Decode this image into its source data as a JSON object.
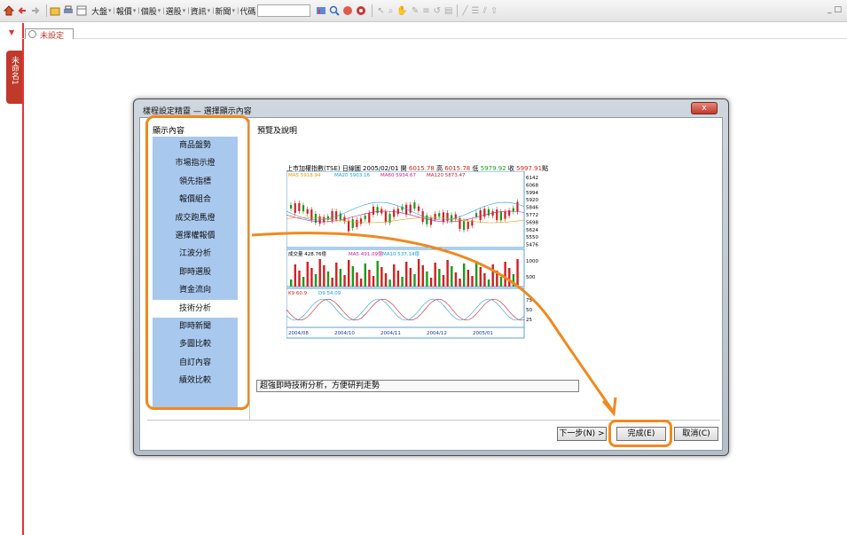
{
  "toolbar": {
    "menus": [
      "大盤",
      "報價",
      "個股",
      "選股",
      "資訊",
      "新聞",
      "代碼"
    ],
    "window_control": "_ □"
  },
  "document": {
    "tab_label": "未設定",
    "vertical_tab_label": "未命名1"
  },
  "dialog": {
    "title": "樣程設定精靈 — 選擇顯示內容",
    "close_label": "x",
    "list_header": "顯示內容",
    "items": [
      {
        "label": "商品盤勢",
        "selected": false
      },
      {
        "label": "市場指示燈",
        "selected": false
      },
      {
        "label": "領先指標",
        "selected": false
      },
      {
        "label": "報價組合",
        "selected": false
      },
      {
        "label": "成交跑馬燈",
        "selected": false
      },
      {
        "label": "選擇權報價",
        "selected": false
      },
      {
        "label": "江波分析",
        "selected": false
      },
      {
        "label": "即時選股",
        "selected": false
      },
      {
        "label": "資金流向",
        "selected": false
      },
      {
        "label": "技術分析",
        "selected": true
      },
      {
        "label": "即時新聞",
        "selected": false
      },
      {
        "label": "多圖比較",
        "selected": false
      },
      {
        "label": "自訂內容",
        "selected": false
      },
      {
        "label": "績效比較",
        "selected": false
      }
    ],
    "preview_header": "預覽及說明",
    "description": "超強即時技術分析，方便研判走勢",
    "buttons": {
      "next": "下一步(N) >",
      "done": "完成(E)",
      "cancel": "取消(C)"
    }
  },
  "preview_chart": {
    "title_prefix": "上市加權指數(TSE) 日線圖 2005/02/01",
    "open_label": "開",
    "open": "6015.78",
    "high_label": "高",
    "high": "6015.78",
    "low_label": "低",
    "low": "5979.92",
    "close_label": "收",
    "close": "5997.91",
    "close_unit": "點",
    "ma_labels": [
      "MA5 5918.94",
      "MA20 5903.16",
      "MA60 5934.67",
      "MA120 5873.47"
    ],
    "price_axis": [
      "6142",
      "6068",
      "5994",
      "5920",
      "5846",
      "5772",
      "5698",
      "5624",
      "5550",
      "5476"
    ],
    "volume_label": "成交量 428.76億",
    "volume_ma": [
      "MA5 491.09億",
      "MA10 537.14億"
    ],
    "volume_axis": [
      "1000",
      "500"
    ],
    "kd_labels": [
      "K9 60.9",
      "D9 54.09"
    ],
    "kd_axis": [
      "75",
      "50",
      "25"
    ],
    "date_axis": [
      "2004/08",
      "2004/10",
      "2004/11",
      "2004/12",
      "2005/01"
    ],
    "colors": {
      "up": "#d21f1f",
      "down": "#1a9a1a",
      "accent": "#f0891e"
    }
  }
}
